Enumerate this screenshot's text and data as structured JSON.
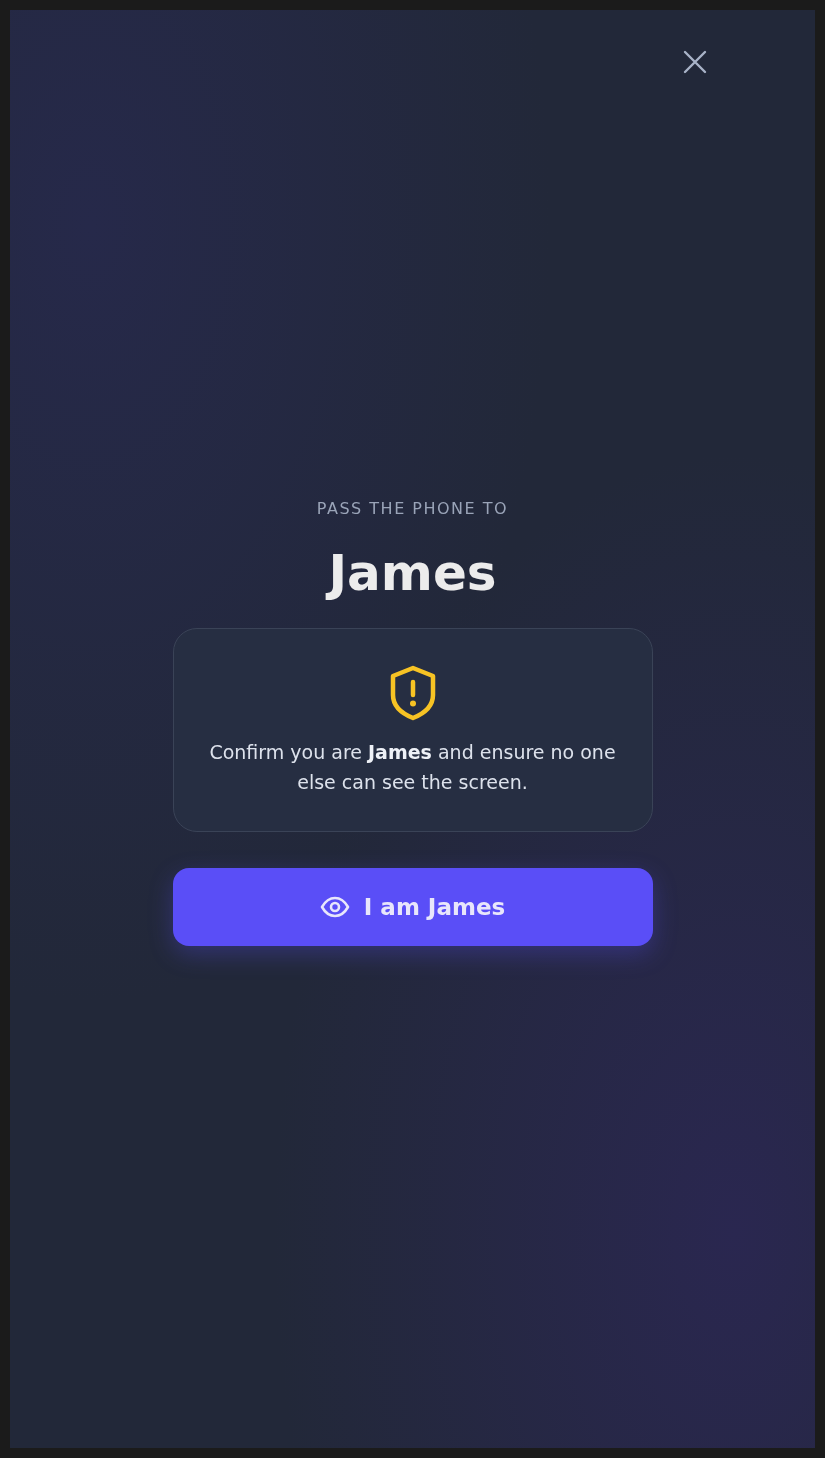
{
  "prompt": "PASS THE PHONE TO",
  "player_name": "James",
  "notice": {
    "message": "Confirm you are **James** and ensure no one else can see the screen."
  },
  "confirm_button": {
    "label": "I am James"
  }
}
